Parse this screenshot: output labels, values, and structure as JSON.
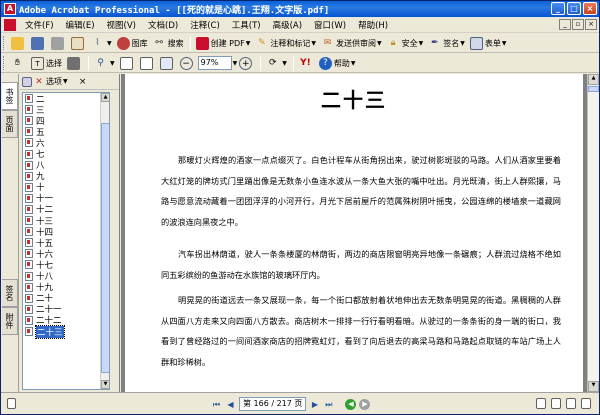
{
  "window": {
    "title": "Adobe Acrobat Professional - [[死的就是心跳].王翔.文字版.pdf]",
    "min": "_",
    "max": "□",
    "close": "×"
  },
  "menu": [
    "文件(F)",
    "编辑(E)",
    "视图(V)",
    "文档(D)",
    "注释(C)",
    "工具(T)",
    "高级(A)",
    "窗口(W)",
    "帮助(H)"
  ],
  "toolbar1": {
    "create_pdf": "创建 PDF",
    "comment_markup": "注释和标记",
    "send_review": "发送供审阅",
    "security": "安全",
    "sign": "签名",
    "forms": "表单",
    "organizer": "图库",
    "search": "搜索"
  },
  "toolbar2": {
    "select": "选择",
    "zoom": "97%",
    "help": "帮助"
  },
  "side_tabs": [
    "书签",
    "页面",
    "签名",
    "附件"
  ],
  "bookmark_panel": {
    "options": "选项"
  },
  "bookmarks": [
    "二",
    "三",
    "四",
    "五",
    "六",
    "七",
    "八",
    "九",
    "十",
    "十一",
    "十二",
    "十三",
    "十四",
    "十五",
    "十六",
    "十七",
    "十八",
    "十九",
    "二十",
    "二十一",
    "二十二",
    "二十三"
  ],
  "selected_bookmark": "二十三",
  "page": {
    "heading": "二十三",
    "paragraphs": [
      "那暖灯火辉煌的酒家一点点缀灭了。白色计程车从街角拐出来，驶过树影斑驳的马路。人们从酒家里要着大红灯笼的牌坊式门里踊出像是无数条小鱼连水波从一条大鱼大张的嘴中吐出。月光既清，街上人群熙攘，马路与愿意流动藏着一团团浮浮的小河开行，月光下居前屋斤的范属殊树阴叶摇曳，公园连绵的楼墙泉一道藏网的波浪连向黑夜之中。",
      "汽车拐出林荫道，驶人一条条楼厦的林荫街，两边的商店限窗明亮异地像一条碾痕；人群流过烧格不绝如同五彩缤纷的鱼游动在水族馆的玻璃环厅内。",
      "明晃晃的街道远去一条又展现一条，每一个街口都放射着状地伸出去无数条明晃晃的街道。黑稠稠的人群从四面八方走来又向四面八方散去。商店树木一排排一行行看明看暗。从驶过的一条条街的身一端的街口，我看到了曾经路过的一间间酒家商店的招牌霓虹灯，看到了向后退去的高梁马路和马路起点取链的车站广场上人群和珍稀树。"
    ]
  },
  "status": {
    "page_indicator": "第 166 / 217 页"
  },
  "colors": {
    "titlebar": "#0a5fd8",
    "selection": "#316ac5",
    "doc_bg": "#808080"
  }
}
